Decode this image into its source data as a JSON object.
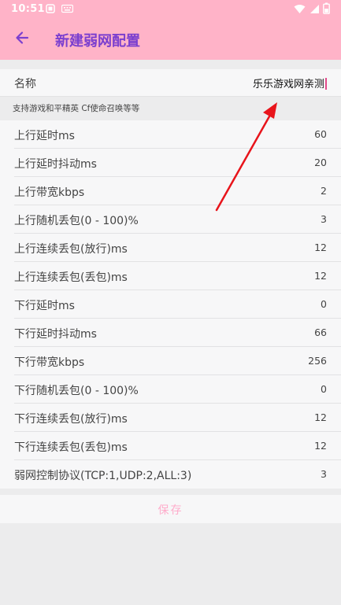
{
  "status_bar": {
    "time": "10:51",
    "icons": [
      "notification-icon",
      "keyboard-icon",
      "wifi-icon",
      "signal-icon",
      "battery-icon"
    ]
  },
  "app_bar": {
    "back_icon": "arrow-left-icon",
    "title": "新建弱网配置"
  },
  "name_field": {
    "label": "名称",
    "value": "乐乐游戏网亲测"
  },
  "hint": "支持游戏和平精英 Cf使命召唤等等",
  "settings": [
    {
      "label": "上行延时ms",
      "value": "60"
    },
    {
      "label": "上行延时抖动ms",
      "value": "20"
    },
    {
      "label": "上行带宽kbps",
      "value": "2"
    },
    {
      "label": "上行随机丢包(0 - 100)%",
      "value": "3"
    },
    {
      "label": "上行连续丢包(放行)ms",
      "value": "12"
    },
    {
      "label": "上行连续丢包(丢包)ms",
      "value": "12"
    },
    {
      "label": "下行延时ms",
      "value": "0"
    },
    {
      "label": "下行延时抖动ms",
      "value": "66"
    },
    {
      "label": "下行带宽kbps",
      "value": "256"
    },
    {
      "label": "下行随机丢包(0 - 100)%",
      "value": "0"
    },
    {
      "label": "下行连续丢包(放行)ms",
      "value": "12"
    },
    {
      "label": "下行连续丢包(丢包)ms",
      "value": "12"
    },
    {
      "label": "弱网控制协议(TCP:1,UDP:2,ALL:3)",
      "value": "3"
    }
  ],
  "save_button": "保存",
  "colors": {
    "app_bar": "#ffb3c8",
    "title": "#7b3fcf",
    "save_text": "#ffaccb",
    "annotation_arrow": "#e8141b"
  }
}
